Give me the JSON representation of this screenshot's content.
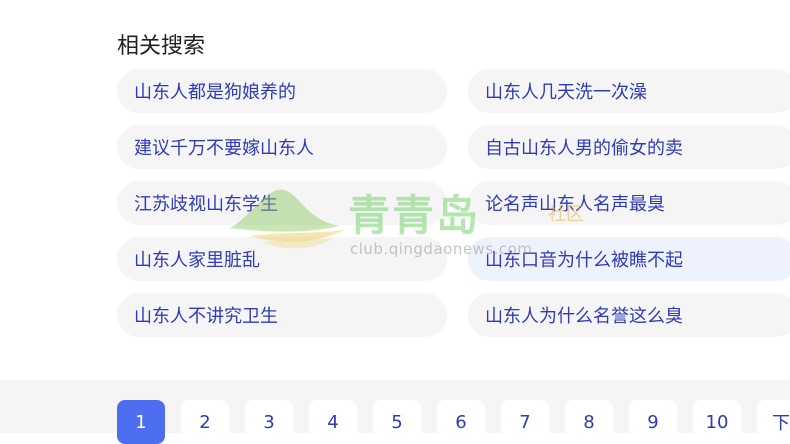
{
  "related": {
    "title": "相关搜索",
    "items": [
      {
        "label": "山东人都是狗娘养的"
      },
      {
        "label": "山东人几天洗一次澡"
      },
      {
        "label": "建议千万不要嫁山东人"
      },
      {
        "label": "自古山东人男的偷女的卖"
      },
      {
        "label": "江苏歧视山东学生"
      },
      {
        "label": "论名声山东人名声最臭"
      },
      {
        "label": "山东人家里脏乱"
      },
      {
        "label": "山东口音为什么被瞧不起"
      },
      {
        "label": "山东人不讲究卫生"
      },
      {
        "label": "山东人为什么名誉这么臭"
      }
    ]
  },
  "watermark": {
    "brand": "青青岛",
    "suffix": "社区",
    "url": "club.qingdaonews.com"
  },
  "pagination": {
    "pages": [
      "1",
      "2",
      "3",
      "4",
      "5",
      "6",
      "7",
      "8",
      "9",
      "10"
    ],
    "current": "1",
    "next_label": "下"
  },
  "colors": {
    "link": "#2f3bb7",
    "accent": "#4e6ef2",
    "chip_bg": "#f5f5f6",
    "chip_hover_bg": "#eef2fd"
  }
}
